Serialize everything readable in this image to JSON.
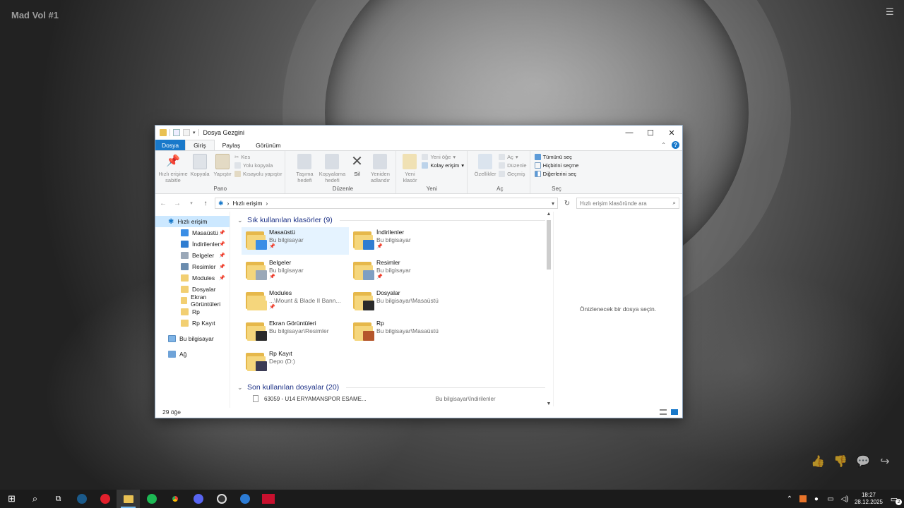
{
  "wallpaper": {
    "title": "Mad Vol #1"
  },
  "window": {
    "title": "Dosya Gezgini",
    "controls": {
      "minimize": "—",
      "maximize": "☐",
      "close": "✕"
    }
  },
  "tabs": [
    {
      "label": "Dosya"
    },
    {
      "label": "Giriş"
    },
    {
      "label": "Paylaş"
    },
    {
      "label": "Görünüm"
    }
  ],
  "ribbon": {
    "pano": {
      "label": "Pano",
      "pin": "Hızlı erişime sabitle",
      "copy": "Kopyala",
      "paste": "Yapıştır",
      "cut": "Kes",
      "copy_path": "Yolu kopyala",
      "paste_shortcut": "Kısayolu yapıştır"
    },
    "duzenle": {
      "label": "Düzenle",
      "move": "Taşıma hedefi",
      "copyto": "Kopyalama hedefi",
      "delete": "Sil",
      "rename": "Yeniden adlandır"
    },
    "yeni": {
      "label": "Yeni",
      "new_folder": "Yeni klasör",
      "new_item": "Yeni öğe",
      "easy_access": "Kolay erişim"
    },
    "ac": {
      "label": "Aç",
      "properties": "Özellikler",
      "open": "Aç",
      "edit": "Düzenle",
      "history": "Geçmiş"
    },
    "sec": {
      "label": "Seç",
      "select_all": "Tümünü seç",
      "select_none": "Hiçbirini seçme",
      "invert": "Diğerlerini seç"
    }
  },
  "address": {
    "path": "Hızlı erişim",
    "search_placeholder": "Hızlı erişim klasöründe ara"
  },
  "nav": {
    "quick_access": "Hızlı erişim",
    "items": [
      {
        "label": "Masaüstü",
        "pinned": true,
        "color": "#3a8ee6"
      },
      {
        "label": "İndirilenler",
        "pinned": true,
        "color": "#2f7dd1"
      },
      {
        "label": "Belgeler",
        "pinned": true,
        "color": "#9aa8b8"
      },
      {
        "label": "Resimler",
        "pinned": true,
        "color": "#6b8cae"
      },
      {
        "label": "Modules",
        "pinned": true,
        "color": "#f2cf72"
      },
      {
        "label": "Dosyalar",
        "pinned": false,
        "color": "#f2cf72"
      },
      {
        "label": "Ekran Görüntüleri",
        "pinned": false,
        "color": "#f2cf72"
      },
      {
        "label": "Rp",
        "pinned": false,
        "color": "#f2cf72"
      },
      {
        "label": "Rp Kayıt",
        "pinned": false,
        "color": "#f2cf72"
      }
    ],
    "this_pc": "Bu bilgisayar",
    "network": "Ağ"
  },
  "frequent": {
    "header": "Sık kullanılan klasörler (9)",
    "folders": [
      {
        "name": "Masaüstü",
        "location": "Bu bilgisayar",
        "pinned": true,
        "overlay": "#3a8ee6"
      },
      {
        "name": "İndirilenler",
        "location": "Bu bilgisayar",
        "pinned": true,
        "overlay": "#2f7dd1"
      },
      {
        "name": "Belgeler",
        "location": "Bu bilgisayar",
        "pinned": true,
        "overlay": "#9aa8b8"
      },
      {
        "name": "Resimler",
        "location": "Bu bilgisayar",
        "pinned": true,
        "overlay": "#7f9fc2"
      },
      {
        "name": "Modules",
        "location": "...\\Mount & Blade II Bann...",
        "pinned": true,
        "overlay": "#f5d67c"
      },
      {
        "name": "Dosyalar",
        "location": "Bu bilgisayar\\Masaüstü",
        "pinned": false,
        "overlay": "#2a2a2a"
      },
      {
        "name": "Ekran Görüntüleri",
        "location": "Bu bilgisayar\\Resimler",
        "pinned": false,
        "overlay": "#2a2a2a"
      },
      {
        "name": "Rp",
        "location": "Bu bilgisayar\\Masaüstü",
        "pinned": false,
        "overlay": "#b5562b"
      },
      {
        "name": "Rp Kayıt",
        "location": "Depo (D:)",
        "pinned": false,
        "overlay": "#3b3b55"
      }
    ]
  },
  "recent": {
    "header": "Son kullanılan dosyalar (20)",
    "first_file": "63059 - U14 ERYAMANSPOR ESAME...",
    "first_location": "Bu bilgisayar\\İndirilenler"
  },
  "preview": {
    "text": "Önizlenecek bir dosya seçin."
  },
  "status": {
    "count": "29 öğe"
  },
  "taskbar": {
    "time": "18:27",
    "date": "28.12.2025",
    "notifications": "2"
  }
}
